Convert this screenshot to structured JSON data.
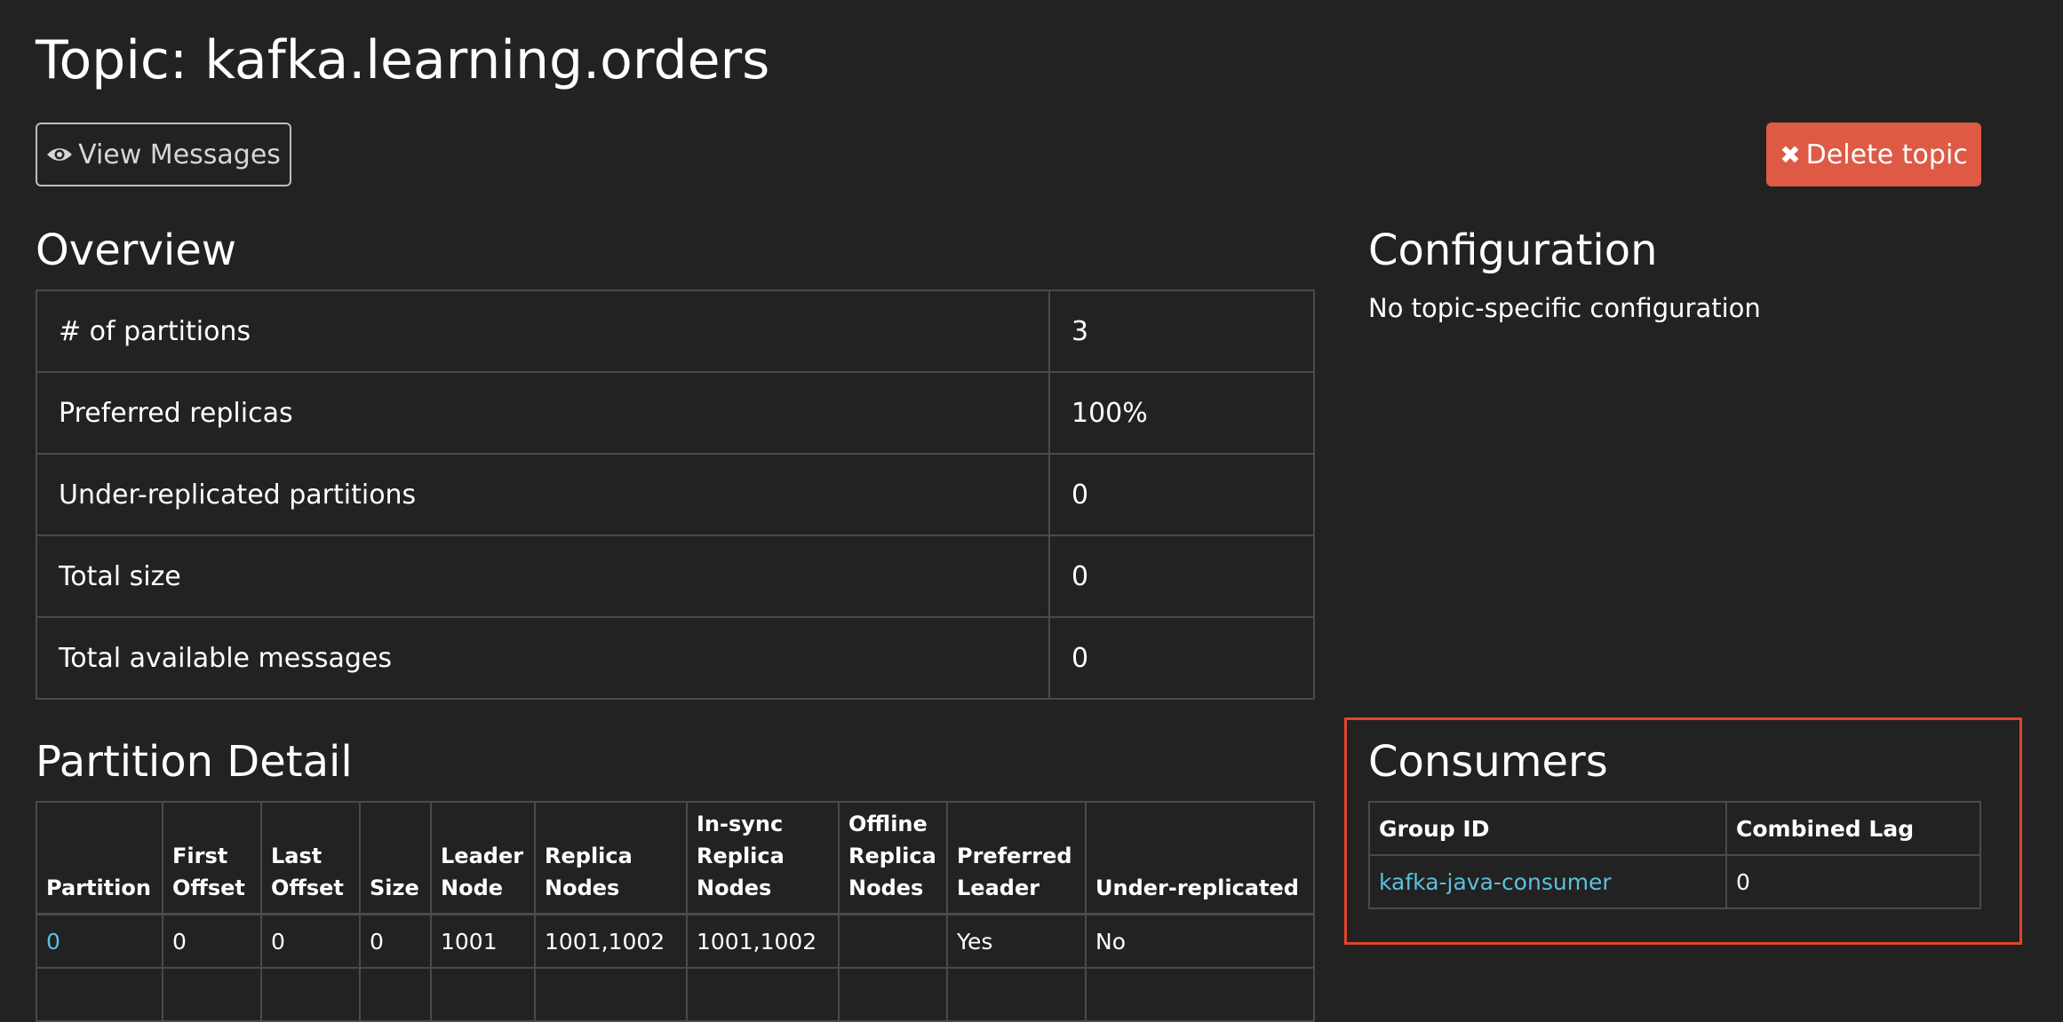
{
  "page_title": "Topic: kafka.learning.orders",
  "view_messages_button": "View Messages",
  "delete_topic_button": "Delete topic",
  "overview": {
    "heading": "Overview",
    "rows": [
      {
        "label": "# of partitions",
        "value": "3"
      },
      {
        "label": "Preferred replicas",
        "value": "100%"
      },
      {
        "label": "Under-replicated partitions",
        "value": "0"
      },
      {
        "label": "Total size",
        "value": "0"
      },
      {
        "label": "Total available messages",
        "value": "0"
      }
    ]
  },
  "configuration": {
    "heading": "Configuration",
    "text": "No topic-specific configuration"
  },
  "partition_detail": {
    "heading": "Partition Detail",
    "headers": [
      "Partition",
      "First Offset",
      "Last Offset",
      "Size",
      "Leader Node",
      "Replica Nodes",
      "In-sync Replica Nodes",
      "Offline Replica Nodes",
      "Preferred Leader",
      "Under-replicated"
    ],
    "rows": [
      [
        "0",
        "0",
        "0",
        "0",
        "1001",
        "1001,1002",
        "1001,1002",
        "",
        "Yes",
        "No"
      ]
    ]
  },
  "consumers": {
    "heading": "Consumers",
    "headers": [
      "Group ID",
      "Combined Lag"
    ],
    "rows": [
      [
        "kafka-java-consumer",
        "0"
      ]
    ]
  },
  "colors": {
    "background": "#222222",
    "link": "#5bc0de",
    "danger": "#de5a45",
    "highlight": "#e0452c"
  },
  "icons": {
    "view_messages": "eye-icon",
    "delete_topic": "times-icon"
  }
}
